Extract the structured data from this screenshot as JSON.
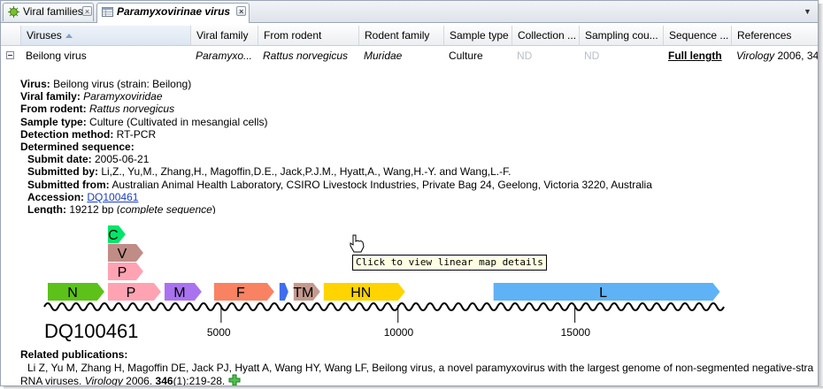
{
  "tabs": [
    {
      "label": "Viral families",
      "active": false
    },
    {
      "label": "Paramyxovirinae virus",
      "active": true
    }
  ],
  "columns": [
    "Viruses",
    "Viral family",
    "From rodent",
    "Rodent family",
    "Sample type",
    "Collection ...",
    "Sampling cou...",
    "Sequence ...",
    "References"
  ],
  "row": {
    "virus": "Beilong virus",
    "viral_family": "Paramyxo...",
    "from_rodent": "Rattus norvegicus",
    "rodent_family": "Muridae",
    "sample_type": "Culture",
    "collection": "ND",
    "sampling_country": "ND",
    "sequence": "Full length",
    "ref_journal": "Virology",
    "ref_rest": " 2006, 34"
  },
  "details": {
    "virus_label": "Virus:",
    "virus_value": " Beilong virus (strain: Beilong)",
    "family_label": "Viral family:",
    "family_value": "Paramyxoviridae",
    "rodent_label": "From rodent:",
    "rodent_value": "Rattus norvegicus",
    "sample_label": "Sample type:",
    "sample_value": " Culture (Cultivated in mesangial cells)",
    "method_label": "Detection method:",
    "method_value": " RT-PCR",
    "seq_label": "Determined sequence:",
    "submit_label": "Submit date:",
    "submit_value": " 2005-06-21",
    "by_label": "Submitted by:",
    "by_value": " Li,Z., Yu,M., Zhang,H., Magoffin,D.E., Jack,P.J.M., Hyatt,A., Wang,H.-Y. and Wang,L.-F.",
    "from_label": "Submitted from:",
    "from_value": " Australian Animal Health Laboratory, CSIRO Livestock Industries, Private Bag 24, Geelong, Victoria 3220, Australia",
    "acc_label": "Accession:",
    "acc_value": "DQ100461",
    "len_label": "Length:",
    "len_value": " 19212 bp (",
    "len_link": "complete sequence",
    "len_close": ")"
  },
  "genome_map": {
    "accession": "DQ100461",
    "length_bp": 19212,
    "ticks": [
      5000,
      10000,
      15000
    ],
    "tooltip": "Click to view linear map details",
    "genes": [
      {
        "label": "N",
        "color": "#5cc21a",
        "start": 100,
        "end": 1700,
        "row": 0
      },
      {
        "label": "P",
        "color": "#ffa3b3",
        "start": 1800,
        "end": 3300,
        "row": 0
      },
      {
        "label": "M",
        "color": "#a973f0",
        "start": 3400,
        "end": 4450,
        "row": 0
      },
      {
        "label": "F",
        "color": "#f98262",
        "start": 4800,
        "end": 6500,
        "row": 0
      },
      {
        "label": "",
        "color": "#3f6ef0",
        "start": 6650,
        "end": 6900,
        "row": 0
      },
      {
        "label": "TM",
        "color": "#c49a8e",
        "start": 7050,
        "end": 7800,
        "row": 0
      },
      {
        "label": "HN",
        "color": "#ffd400",
        "start": 7900,
        "end": 10200,
        "row": 0
      },
      {
        "label": "L",
        "color": "#5fb2f5",
        "start": 12700,
        "end": 19100,
        "row": 0
      },
      {
        "label": "P",
        "color": "#ffa3b3",
        "start": 1800,
        "end": 2800,
        "row": 1
      },
      {
        "label": "V",
        "color": "#c08c86",
        "start": 1800,
        "end": 2800,
        "row": 2
      },
      {
        "label": "C",
        "color": "#00e66a",
        "start": 1800,
        "end": 2300,
        "row": 3
      }
    ]
  },
  "publications": {
    "label": "Related publications:",
    "line1": "Li Z, Yu M, Zhang H, Magoffin DE, Jack PJ, Hyatt A, Wang HY, Wang LF, Beilong virus, a novel paramyxovirus with the largest genome of non-segmented negative-stra",
    "line2_start": "RNA viruses. ",
    "journal": "Virology",
    "year": " 2006. ",
    "volume": "346",
    "pages": "(1):219-28."
  }
}
